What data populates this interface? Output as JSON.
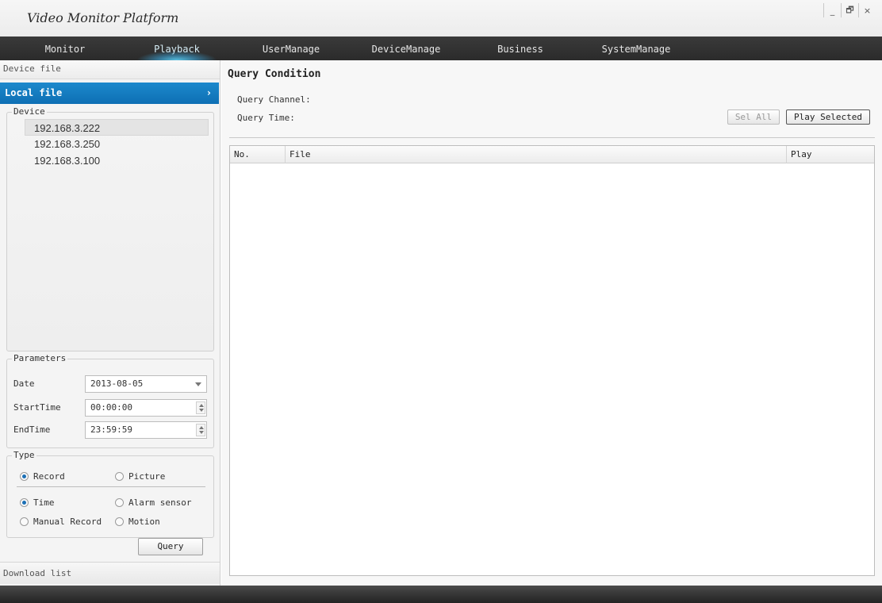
{
  "app": {
    "title": "Video Monitor Platform",
    "window_controls": [
      "_",
      "🗗",
      "×"
    ]
  },
  "menu": {
    "items": [
      {
        "label": "Monitor"
      },
      {
        "label": "Playback",
        "active": true
      },
      {
        "label": "UserManage"
      },
      {
        "label": "DeviceManage"
      },
      {
        "label": "Business"
      },
      {
        "label": "SystemManage"
      }
    ]
  },
  "left": {
    "device_file_label": "Device file",
    "local_file_label": "Local file",
    "device_group_label": "Device",
    "devices": [
      "192.168.3.222",
      "192.168.3.250",
      "192.168.3.100"
    ],
    "selected_device": "192.168.3.222",
    "parameters": {
      "label": "Parameters",
      "date_label": "Date",
      "date_value": "2013-08-05",
      "start_label": "StartTime",
      "start_value": "00:00:00",
      "end_label": "EndTime",
      "end_value": "23:59:59"
    },
    "type": {
      "label": "Type",
      "record": "Record",
      "picture": "Picture",
      "time": "Time",
      "alarm_sensor": "Alarm sensor",
      "manual_record": "Manual Record",
      "motion": "Motion"
    },
    "query_button": "Query",
    "download_list_label": "Download list"
  },
  "main": {
    "query_condition_title": "Query Condition",
    "query_channel_label": "Query Channel:",
    "query_time_label": "Query Time:",
    "sel_all_button": "Sel All",
    "play_selected_button": "Play Selected",
    "table": {
      "columns": [
        "No.",
        "File",
        "Play"
      ],
      "rows": []
    }
  },
  "colors": {
    "accent": "#1278bf",
    "menubar": "#2f2f2f",
    "active_glow": "#5ac8eb"
  }
}
